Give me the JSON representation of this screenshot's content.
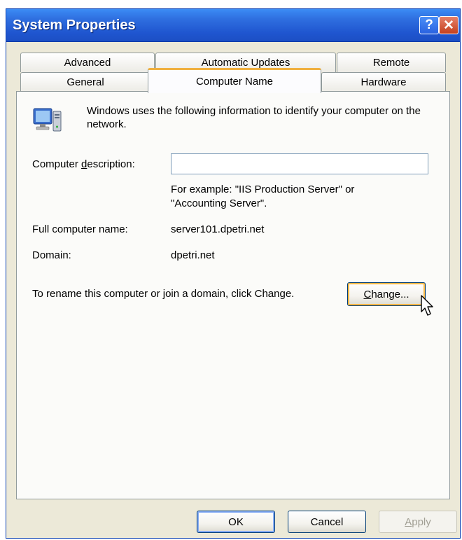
{
  "window": {
    "title": "System Properties",
    "help_label": "?",
    "close_label": "✕"
  },
  "tabs": {
    "back_row": [
      "Advanced",
      "Automatic Updates",
      "Remote"
    ],
    "front_row": [
      "General",
      "Computer Name",
      "Hardware"
    ],
    "active": "Computer Name"
  },
  "panel": {
    "intro": "Windows uses the following information to identify your computer on the network.",
    "description_label_before": "Computer ",
    "description_label_access": "d",
    "description_label_after": "escription:",
    "description_value": "",
    "example_text": "For example: \"IIS Production Server\" or \"Accounting Server\".",
    "full_name_label": "Full computer name:",
    "full_name_value": "server101.dpetri.net",
    "domain_label": "Domain:",
    "domain_value": "dpetri.net",
    "rename_text": "To rename this computer or join a domain, click Change.",
    "change_access": "C",
    "change_rest": "hange..."
  },
  "buttons": {
    "ok": "OK",
    "cancel": "Cancel",
    "apply_access": "A",
    "apply_rest": "pply"
  },
  "icons": {
    "help": "help-icon",
    "close": "close-icon",
    "computer": "computer-network-icon",
    "cursor": "mouse-pointer-icon"
  },
  "colors": {
    "titlebar": "#245edb",
    "dialog_bg": "#ece9d8",
    "active_tab_accent": "#f0b040",
    "default_button_focus": "#f8b848"
  }
}
